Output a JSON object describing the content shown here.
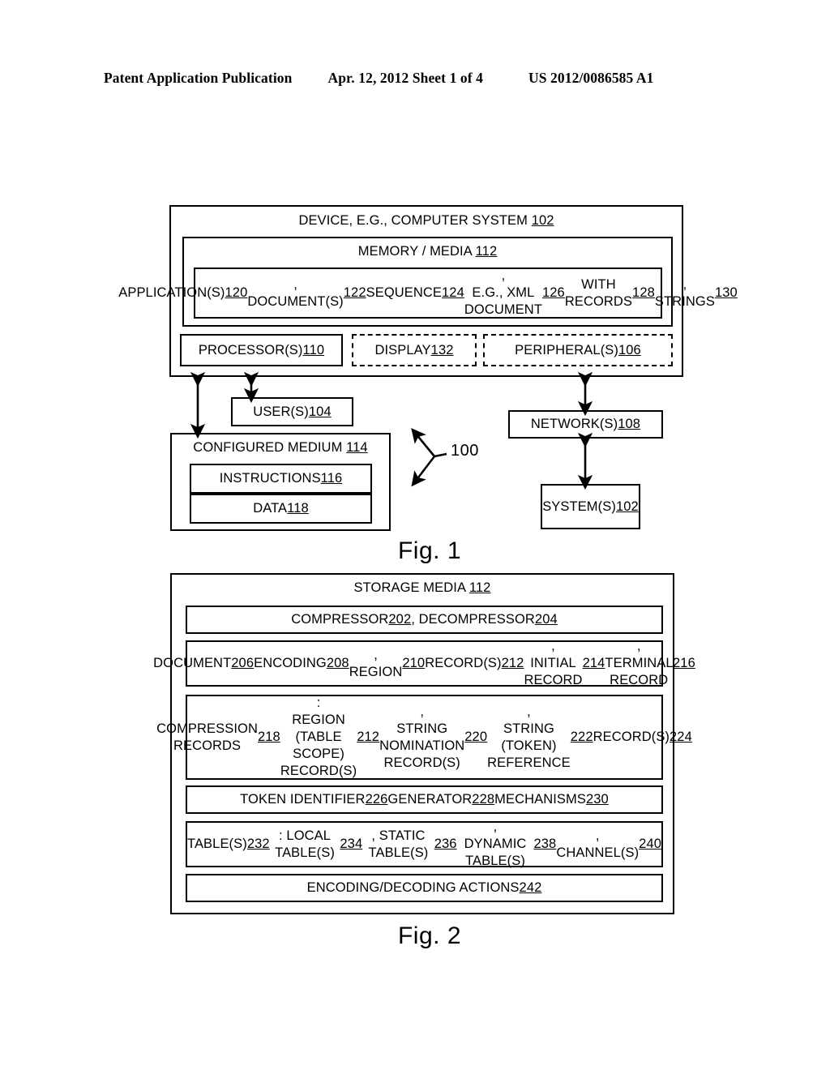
{
  "header": {
    "publication": "Patent Application Publication",
    "date_sheet": "Apr. 12, 2012  Sheet 1 of 4",
    "patent_number": "US 2012/0086585 A1"
  },
  "figures": [
    {
      "caption": "Fig. 1",
      "reference_label": "100",
      "boxes": {
        "device": "DEVICE, E.G., COMPUTER SYSTEM 102",
        "memory": "MEMORY / MEDIA 112",
        "applications": "APPLICATION(S) 120, DOCUMENT(S) 122 SEQUENCE 124,\nE.G., XML DOCUMENT 126 WITH RECORDS 128, STRINGS 130",
        "processors": "PROCESSOR(S) 110",
        "display": "DISPLAY 132",
        "peripherals": "PERIPHERAL(S) 106",
        "users": "USER(S) 104",
        "configured_medium": "CONFIGURED MEDIUM 114",
        "instructions": "INSTRUCTIONS 116",
        "data": "DATA 118",
        "networks": "NETWORK(S) 108",
        "systems": "SYSTEM(S)\n102"
      }
    },
    {
      "caption": "Fig. 2",
      "boxes": {
        "storage_media": "STORAGE MEDIA 112",
        "compressor": "COMPRESSOR 202, DECOMPRESSOR 204",
        "document": "DOCUMENT 206 ENCODING 208, REGION 210 RECORD(S) 212,\nINITIAL RECORD 214, TERMINAL RECORD 216",
        "compression_records": "COMPRESSION RECORDS 218:\nREGION (TABLE SCOPE) RECORD(S) 212,\nSTRING NOMINATION RECORD(S) 220,\nSTRING (TOKEN) REFERENCE 222 RECORD(S) 224",
        "token_identifier": "TOKEN IDENTIFIER 226 GENERATOR 228 MECHANISMS 230",
        "tables": "TABLE(S) 232: LOCAL TABLE(S) 234, STATIC TABLE(S) 236,\nDYNAMIC TABLE(S) 238, CHANNEL(S) 240",
        "encoding_actions": "ENCODING/DECODING ACTIONS 242"
      }
    }
  ],
  "reference_numerals": {
    "device": "102",
    "users": "104",
    "peripherals": "106",
    "networks": "108",
    "processors": "110",
    "memory": "112",
    "configured_medium": "114",
    "instructions": "116",
    "data": "118",
    "applications": "120",
    "documents": "122",
    "sequence": "124",
    "xml_document": "126",
    "records": "128",
    "strings": "130",
    "display": "132",
    "compressor": "202",
    "decompressor": "204",
    "document": "206",
    "encoding": "208",
    "region": "210",
    "region_records": "212",
    "initial_record": "214",
    "terminal_record": "216",
    "compression_records": "218",
    "string_nomination": "220",
    "string_token_reference": "222",
    "reference_records": "224",
    "token_identifier": "226",
    "generator": "228",
    "mechanisms": "230",
    "tables": "232",
    "local_tables": "234",
    "static_tables": "236",
    "dynamic_tables": "238",
    "channels": "240",
    "encoding_decoding_actions": "242",
    "system_100": "100"
  },
  "colors": {
    "ink": "#000000",
    "paper": "#ffffff"
  }
}
